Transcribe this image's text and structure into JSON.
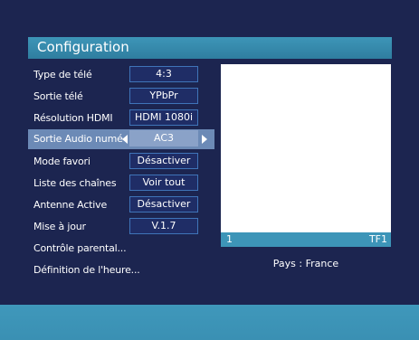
{
  "menu": {
    "title": "Configuration",
    "items": [
      {
        "label": "Type de télé",
        "value": "4:3"
      },
      {
        "label": "Sortie télé",
        "value": "YPbPr"
      },
      {
        "label": "Résolution HDMI",
        "value": "HDMI 1080i"
      },
      {
        "label": "Sortie Audio numé",
        "value": "AC3",
        "selected": true
      },
      {
        "label": "Mode favori",
        "value": "Désactiver"
      },
      {
        "label": "Liste des chaînes",
        "value": "Voir tout"
      },
      {
        "label": "Antenne Active",
        "value": "Désactiver"
      },
      {
        "label": "Mise à jour",
        "value": "V.1.7"
      },
      {
        "label": "Contrôle parental..."
      },
      {
        "label": "Définition de l'heure..."
      }
    ]
  },
  "preview": {
    "channel_number": "1",
    "channel_name": "TF1",
    "country": "Pays : France"
  },
  "colors": {
    "background": "#1c2550",
    "accent": "#3d95b8",
    "selection": "#6c8ab6",
    "value_border": "#3f74b8"
  }
}
